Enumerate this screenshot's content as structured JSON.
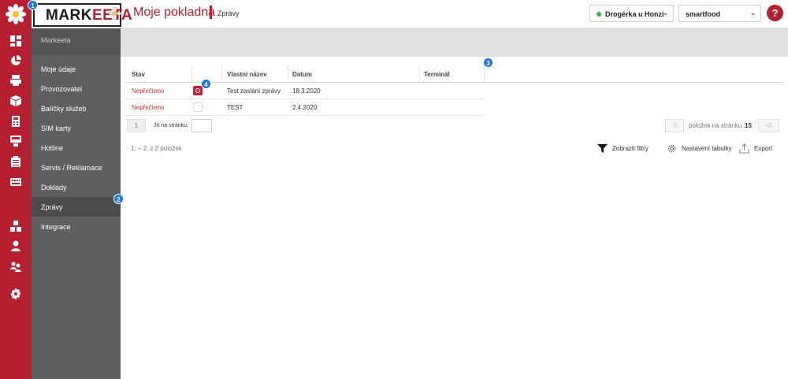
{
  "header": {
    "logo_text_a": "MARK",
    "logo_text_b": "EETA",
    "title": "Moje pokladna",
    "subtitle": "Zprávy",
    "shop_select": "Drogérka u Honzi",
    "company_select": "smartfood",
    "help_label": "?"
  },
  "colors": {
    "brand": "#b51f30",
    "sidebar": "#5e5f61",
    "badge": "#1c76e3",
    "status_ok": "#3ab54a"
  },
  "sidebar": {
    "brand": "Markeeta",
    "items": [
      {
        "label": "Moje údaje"
      },
      {
        "label": "Provozovatel"
      },
      {
        "label": "Balíčky služeb"
      },
      {
        "label": "SIM karty"
      },
      {
        "label": "Hotline"
      },
      {
        "label": "Servis / Reklamace"
      },
      {
        "label": "Doklady"
      },
      {
        "label": "Zprávy"
      },
      {
        "label": "Integrace"
      }
    ],
    "active": "Zprávy"
  },
  "rail_icons": [
    "dashboard-icon",
    "pie-chart-icon",
    "printer-icon",
    "box-icon",
    "calculator-icon",
    "register-icon",
    "clipboard-icon",
    "keyboard-icon",
    "boxes-icon",
    "user-icon",
    "users-icon",
    "settings-icon"
  ],
  "badges": [
    "1",
    "2",
    "3",
    "4"
  ],
  "table": {
    "columns": [
      "Stav",
      "",
      "Vlastní název",
      "Datum",
      "Terminál"
    ],
    "rows": [
      {
        "status": "Nepřečteno",
        "checked": true,
        "name": "Test zaslání zprávy",
        "date": "18.3.2020",
        "terminal": ""
      },
      {
        "status": "Nepřečteno",
        "checked": false,
        "name": "TEST",
        "date": "2.4.2020",
        "terminal": ""
      }
    ]
  },
  "pager": {
    "page": "1",
    "goto_label": "Jít na stránku:",
    "minus": "-5",
    "per_page_label": "položek na stránku",
    "per_page": "15",
    "plus": "+5",
    "count": "1. – 2. z 2 položek"
  },
  "toolbar": {
    "filters": "Zobrazit filtry",
    "settings": "Nastavení tabulky",
    "export": "Export"
  }
}
